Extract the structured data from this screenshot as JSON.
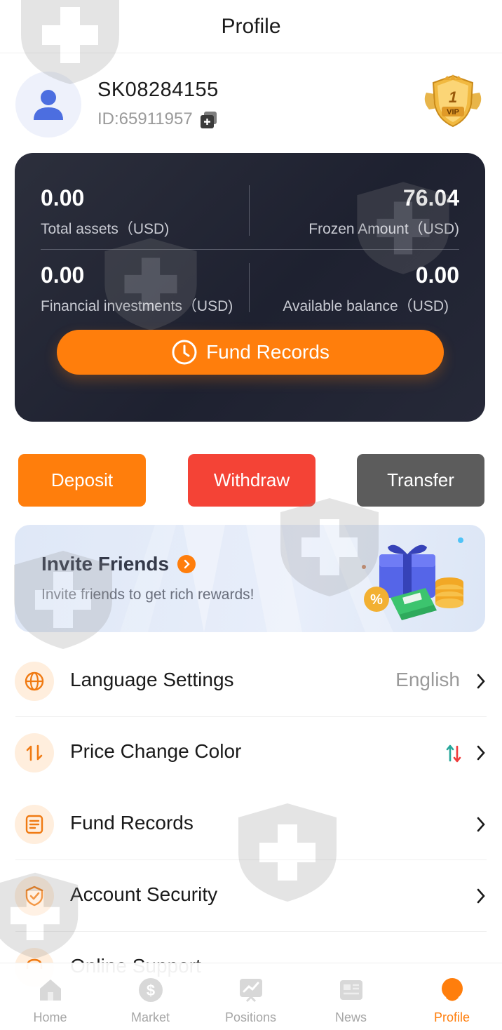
{
  "header": {
    "title": "Profile"
  },
  "user": {
    "username": "SK08284155",
    "id_text": "ID:65911957",
    "vip_level": "1",
    "vip_label": "VIP"
  },
  "assets": {
    "total_value": "0.00",
    "total_label": "Total assets（USD)",
    "frozen_value": "76.04",
    "frozen_label": "Frozen Amount（USD)",
    "financial_value": "0.00",
    "financial_label": "Financial investments（USD)",
    "available_value": "0.00",
    "available_label": "Available balance（USD)",
    "fund_records_button": "Fund Records"
  },
  "actions": {
    "deposit": "Deposit",
    "withdraw": "Withdraw",
    "transfer": "Transfer"
  },
  "invite": {
    "title": "Invite Friends",
    "subtitle": "Invite friends to get rich rewards!",
    "badge": "%"
  },
  "menu": {
    "items": [
      {
        "label": "Language Settings",
        "value": "English",
        "icon": "globe-icon"
      },
      {
        "label": "Price Change Color",
        "value": "",
        "icon": "swap-icon"
      },
      {
        "label": "Fund Records",
        "value": "",
        "icon": "document-icon"
      },
      {
        "label": "Account Security",
        "value": "",
        "icon": "shield-check-icon"
      },
      {
        "label": "Online Support",
        "value": "",
        "icon": "support-icon"
      }
    ]
  },
  "tabbar": {
    "items": [
      {
        "label": "Home",
        "icon": "home-icon",
        "active": false
      },
      {
        "label": "Market",
        "icon": "dollar-coin-icon",
        "active": false
      },
      {
        "label": "Positions",
        "icon": "chart-icon",
        "active": false
      },
      {
        "label": "News",
        "icon": "newspaper-icon",
        "active": false
      },
      {
        "label": "Profile",
        "icon": "profile-icon",
        "active": true
      }
    ]
  },
  "colors": {
    "accent": "#ff7e0c",
    "withdraw": "#f44336",
    "transfer": "#5c5c5c",
    "card_bg": "#23263a",
    "rise": "#26a69a",
    "fall": "#ef3b3b"
  }
}
